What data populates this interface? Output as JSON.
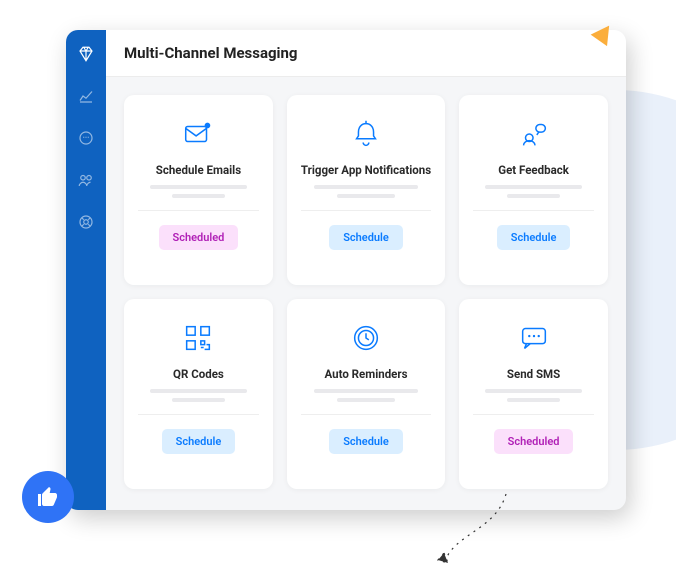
{
  "header": {
    "title": "Multi-Channel Messaging"
  },
  "sidebar": {
    "items": [
      {
        "name": "diamond-icon"
      },
      {
        "name": "chart-icon"
      },
      {
        "name": "chat-icon"
      },
      {
        "name": "users-icon"
      },
      {
        "name": "lifebuoy-icon"
      }
    ]
  },
  "cards": [
    {
      "icon": "mail-icon",
      "title": "Schedule Emails",
      "badge_label": "Scheduled",
      "badge_style": "pink"
    },
    {
      "icon": "bell-icon",
      "title": "Trigger App Notifications",
      "badge_label": "Schedule",
      "badge_style": "blue"
    },
    {
      "icon": "feedback-icon",
      "title": "Get Feedback",
      "badge_label": "Schedule",
      "badge_style": "blue"
    },
    {
      "icon": "qr-icon",
      "title": "QR Codes",
      "badge_label": "Schedule",
      "badge_style": "blue"
    },
    {
      "icon": "clock-icon",
      "title": "Auto Reminders",
      "badge_label": "Schedule",
      "badge_style": "blue"
    },
    {
      "icon": "sms-icon",
      "title": "Send SMS",
      "badge_label": "Scheduled",
      "badge_style": "pink"
    }
  ]
}
